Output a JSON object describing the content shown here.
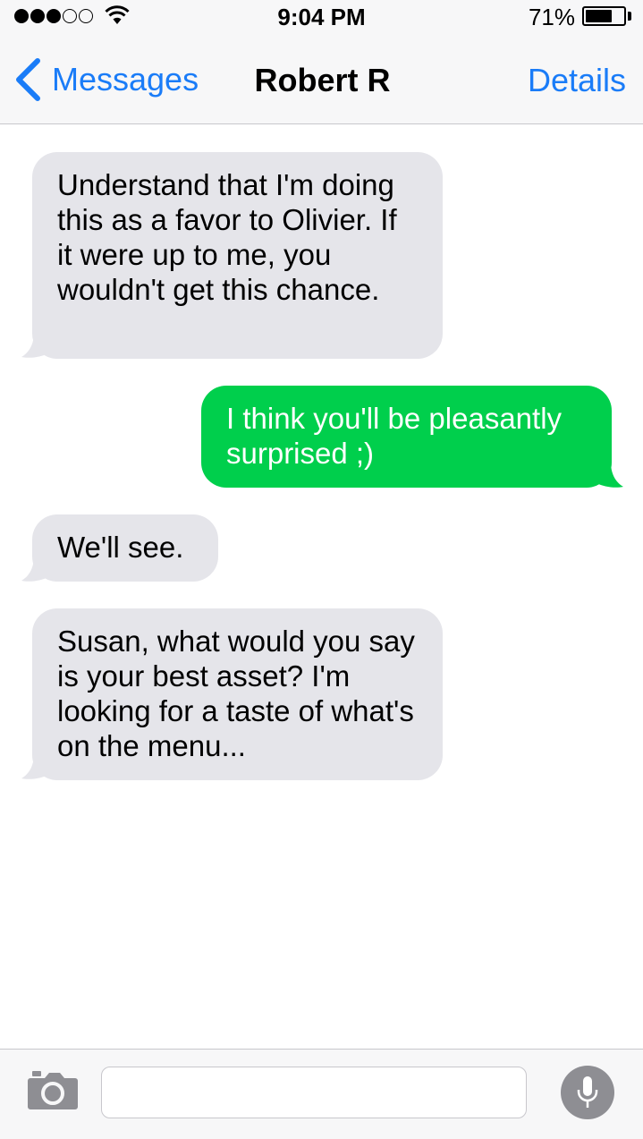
{
  "status_bar": {
    "signal_strength_of_5": 3,
    "time": "9:04 PM",
    "battery_percent": "71%",
    "battery_level": 0.71
  },
  "nav": {
    "back_label": "Messages",
    "title": "Robert R",
    "details_label": "Details"
  },
  "messages": [
    {
      "direction": "incoming",
      "text": "Understand that I'm doing this as a favor to Olivier. If it were up to me, you wouldn't get this chance."
    },
    {
      "direction": "outgoing",
      "text": "I think you'll be pleasantly surprised ;)"
    },
    {
      "direction": "incoming",
      "text": "We'll see."
    },
    {
      "direction": "incoming",
      "text": "Susan, what would you say is your best asset? I'm looking for a taste of what's on the menu..."
    }
  ],
  "composer": {
    "placeholder": "",
    "camera_icon": "camera-icon",
    "mic_icon": "microphone-icon"
  },
  "colors": {
    "accent": "#1a7cf8",
    "incoming_bubble": "#e5e5ea",
    "outgoing_bubble": "#00cf4c"
  }
}
